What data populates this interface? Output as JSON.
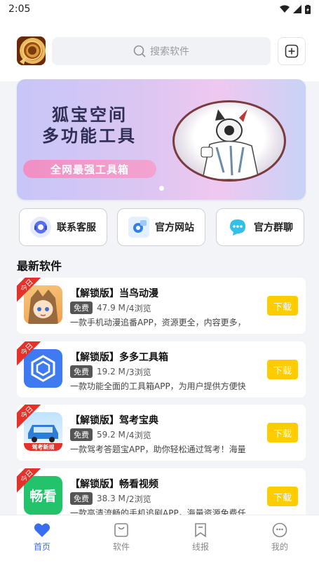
{
  "status_bar": {
    "time": "2:05"
  },
  "header": {
    "search_placeholder": "搜索软件"
  },
  "banner": {
    "title_line1": "狐宝空间",
    "title_line2": "多功能工具",
    "pill_text": "全网最强工具箱"
  },
  "quick_links": [
    {
      "label": "联系客服",
      "icon": "customer-service-icon"
    },
    {
      "label": "官方网站",
      "icon": "website-gear-icon"
    },
    {
      "label": "官方群聊",
      "icon": "group-chat-icon"
    }
  ],
  "section_title": "最新软件",
  "apps": [
    {
      "title": "【解锁版】当鸟动漫",
      "badge": "免费",
      "size": "47.9 M",
      "views": "/4浏览",
      "desc": "一款手机动漫追番APP，资源更全，内容更多，",
      "ribbon": "今日",
      "download": "下载",
      "icon": "anime-girl-icon"
    },
    {
      "title": "【解锁版】多多工具箱",
      "badge": "免费",
      "size": "19.2 M",
      "views": "/3浏览",
      "desc": "一款功能全面的工具箱APP，为用户提供方便快",
      "ribbon": "今日",
      "download": "下载",
      "icon": "toolbox-cube-icon"
    },
    {
      "title": "【解锁版】驾考宝典",
      "badge": "免费",
      "size": "59.2 M",
      "views": "/4浏览",
      "desc": "一款驾考答题宝APP，助你轻松通过驾考！海量",
      "ribbon": "今日",
      "download": "下载",
      "icon": "car-icon",
      "icon_caption": "驾考新规"
    },
    {
      "title": "【解锁版】畅看视频",
      "badge": "免费",
      "size": "38.3 M",
      "views": "/2浏览",
      "desc": "一款高清流畅的手机追剧APP，海量资源免费任",
      "ribbon": "今日",
      "download": "下载",
      "icon": "video-icon",
      "icon_text": "畅看"
    }
  ],
  "bottom_nav": [
    {
      "label": "首页",
      "icon": "heart-icon",
      "active": true
    },
    {
      "label": "软件",
      "icon": "bag-icon",
      "active": false
    },
    {
      "label": "线报",
      "icon": "bookmark-icon",
      "active": false
    },
    {
      "label": "我的",
      "icon": "smile-icon",
      "active": false
    }
  ],
  "colors": {
    "accent": "#3a6df0",
    "download": "#ffcc00",
    "ribbon": "#e4322b"
  }
}
